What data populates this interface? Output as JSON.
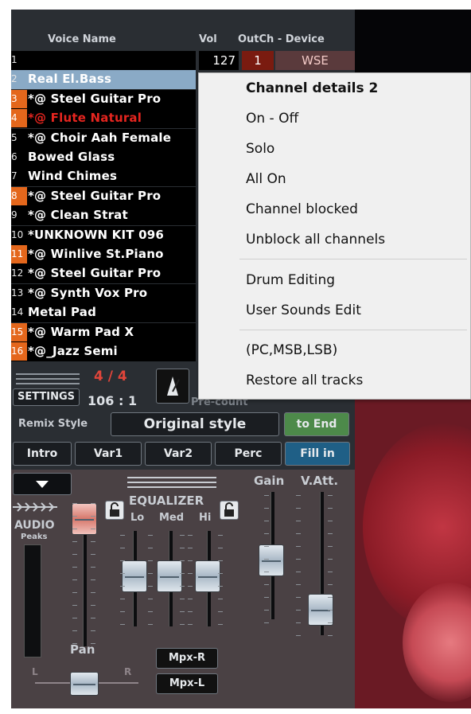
{
  "table": {
    "headers": {
      "voice_name": "Voice Name",
      "vol": "Vol",
      "outch_device": "OutCh - Device"
    },
    "first_row": {
      "vol": "127",
      "outch": "1",
      "device": "WSE"
    },
    "rows": [
      {
        "num": "1",
        "name": ""
      },
      {
        "num": "2",
        "name": "Real El.Bass"
      },
      {
        "num": "3",
        "name": "*@  Steel Guitar Pro"
      },
      {
        "num": "4",
        "name": "*@  Flute Natural"
      },
      {
        "num": "5",
        "name": "*@  Choir Aah Female"
      },
      {
        "num": "6",
        "name": "Bowed Glass"
      },
      {
        "num": "7",
        "name": "Wind Chimes"
      },
      {
        "num": "8",
        "name": "*@  Steel Guitar Pro"
      },
      {
        "num": "9",
        "name": "*@  Clean Strat"
      },
      {
        "num": "10",
        "name": "*UNKNOWN KIT 096"
      },
      {
        "num": "11",
        "name": "*@  Winlive St.Piano"
      },
      {
        "num": "12",
        "name": "*@  Steel Guitar Pro"
      },
      {
        "num": "13",
        "name": "*@  Synth Vox Pro"
      },
      {
        "num": "14",
        "name": "Metal Pad"
      },
      {
        "num": "15",
        "name": "*@  Warm Pad X"
      },
      {
        "num": "16",
        "name": "*@_Jazz Semi"
      }
    ]
  },
  "transport": {
    "settings": "SETTINGS",
    "time_signature": "4 / 4",
    "position": "106 : 1",
    "precount": "Pre-count"
  },
  "style": {
    "remix_label": "Remix Style",
    "style_value": "Original style",
    "to_end": "to End",
    "buttons": [
      "Intro",
      "Var1",
      "Var2",
      "Perc",
      "Fill in"
    ]
  },
  "mixer": {
    "audio": "AUDIO",
    "peaks": "Peaks",
    "equalizer": "EQUALIZER",
    "eq_bands": [
      "Lo",
      "Med",
      "Hi"
    ],
    "gain": "Gain",
    "vatt": "V.Att.",
    "pan": "Pan",
    "pan_l": "L",
    "pan_r": "R",
    "mpx_r": "Mpx-R",
    "mpx_l": "Mpx-L"
  },
  "context_menu": {
    "title": "Channel details 2",
    "group1": [
      "On - Off",
      "Solo",
      "All On",
      "Channel blocked",
      "Unblock all channels"
    ],
    "group2": [
      "Drum Editing",
      "User Sounds Edit"
    ],
    "group3": [
      "(PC,MSB,LSB)",
      "Restore all tracks"
    ]
  },
  "colors": {
    "panel": "#2a2e33",
    "row_number_orange": "#e4671c",
    "selected_row": "#8aaac6",
    "muted_red": "#e5251f",
    "fill_in_blue": "#1f5f86",
    "to_end_green": "#4d8a4a"
  }
}
